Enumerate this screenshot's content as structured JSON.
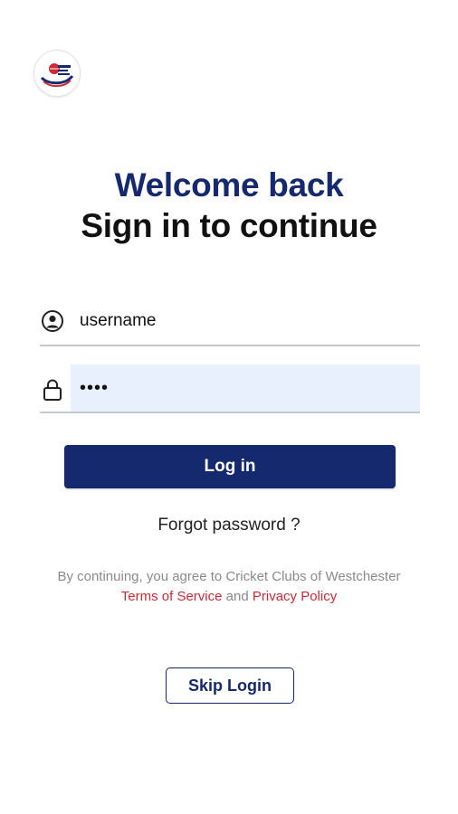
{
  "brand": {
    "logo_icon": "cricket-club-logo",
    "primary_color": "#14296e",
    "link_color": "#cc2a36",
    "autofill_bg": "#e8f0fe"
  },
  "header": {
    "welcome": "Welcome back",
    "subtitle": "Sign in to continue"
  },
  "form": {
    "username": {
      "icon": "user-circle-icon",
      "value": "username"
    },
    "password": {
      "icon": "lock-icon",
      "value": "••••"
    },
    "login_label": "Log in",
    "forgot_label": "Forgot password ?"
  },
  "terms": {
    "prefix": "By continuing, you agree to Cricket Clubs of Westchester",
    "tos_label": "Terms of Service",
    "joiner": "and",
    "privacy_label": "Privacy Policy"
  },
  "skip": {
    "label": "Skip Login"
  }
}
